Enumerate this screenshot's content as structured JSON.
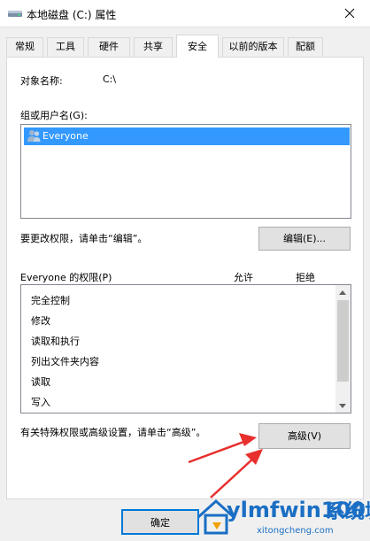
{
  "window": {
    "title": "本地磁盘 (C:) 属性",
    "icon": "drive-icon",
    "close_icon": "close-icon"
  },
  "tabs": [
    {
      "label": "常规"
    },
    {
      "label": "工具"
    },
    {
      "label": "硬件"
    },
    {
      "label": "共享"
    },
    {
      "label": "安全",
      "active": true
    },
    {
      "label": "以前的版本"
    },
    {
      "label": "配额"
    }
  ],
  "security": {
    "object_name_label": "对象名称:",
    "object_name_value": "C:\\",
    "groups_label": "组或用户名(G):",
    "users": [
      {
        "name": "Everyone",
        "selected": true,
        "icon": "user-group-icon"
      }
    ],
    "edit_hint": "要更改权限，请单击“编辑”。",
    "edit_button": "编辑(E)...",
    "permissions_label": "Everyone 的权限(P)",
    "allow_header": "允许",
    "deny_header": "拒绝",
    "permissions": [
      {
        "name": "完全控制"
      },
      {
        "name": "修改"
      },
      {
        "name": "读取和执行"
      },
      {
        "name": "列出文件夹内容"
      },
      {
        "name": "读取"
      },
      {
        "name": "写入"
      }
    ],
    "advanced_hint": "有关特殊权限或高级设置，请单击“高级”。",
    "advanced_button": "高级(V)"
  },
  "footer": {
    "ok_button": "确定"
  },
  "watermark": {
    "brand": "ylmfwin100",
    "domain": "xitongcheng.com",
    "trailing_chars": "系统城"
  },
  "colors": {
    "selection": "#3399ff",
    "arrow": "#e8302e",
    "button_face": "#e1e1e1"
  }
}
